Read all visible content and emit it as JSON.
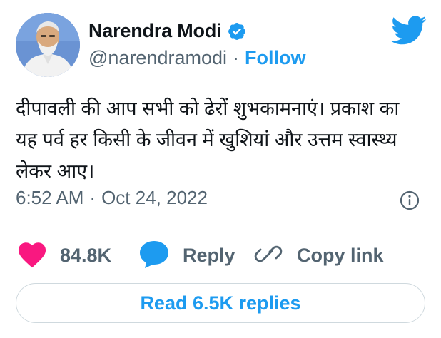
{
  "author": {
    "display_name": "Narendra Modi",
    "handle": "@narendramodi",
    "separator": "·",
    "follow_label": "Follow",
    "verified": true
  },
  "tweet": {
    "text": "दीपावली की आप सभी को ढेरों शुभकामनाएं। प्रकाश का यह पर्व हर किसी के जीवन में खुशियां और उत्तम स्वास्थ्य लेकर आए।",
    "time": "6:52 AM",
    "separator": "·",
    "date": "Oct 24, 2022"
  },
  "actions": {
    "likes_count": "84.8K",
    "reply_label": "Reply",
    "copy_link_label": "Copy link"
  },
  "read_replies_label": "Read 6.5K replies",
  "icons": {
    "like": "heart-icon",
    "reply": "speech-bubble-icon",
    "copy": "link-icon",
    "info": "info-icon",
    "brand": "twitter-bird-icon",
    "verified": "verified-badge-icon"
  },
  "colors": {
    "accent": "#1d9bf0",
    "like": "#f91880",
    "text": "#0f1419",
    "secondary": "#536471",
    "border": "#cfd9de"
  }
}
